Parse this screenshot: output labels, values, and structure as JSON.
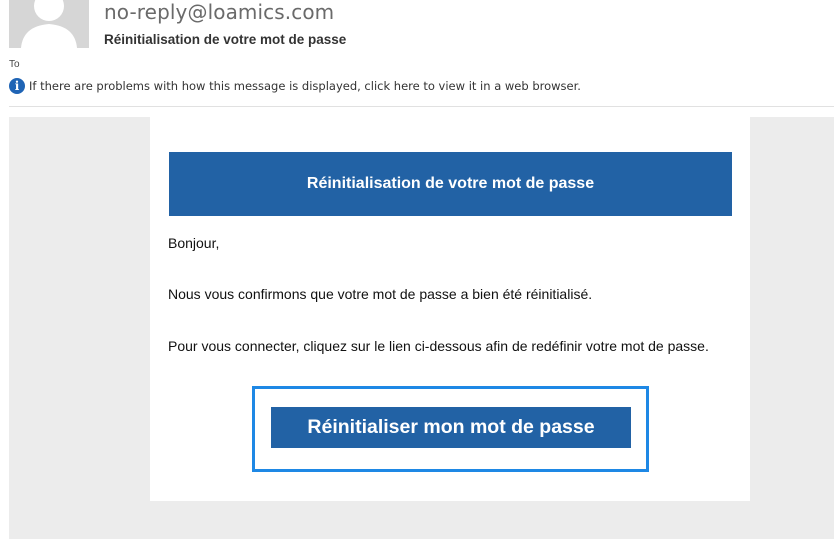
{
  "header": {
    "sender": "no-reply@loamics.com",
    "subject": "Réinitialisation de votre mot de passe",
    "to_label": "To",
    "info_message": "If there are problems with how this message is displayed, click here to view it in a web browser."
  },
  "email": {
    "banner_title": "Réinitialisation de votre mot de passe",
    "greeting": "Bonjour,",
    "paragraph_1": "Nous vous confirmons que votre mot de passe a bien été réinitialisé.",
    "paragraph_2": "Pour vous connecter, cliquez sur le lien ci-dessous afin de redéfinir votre mot de passe.",
    "cta_label": "Réinitialiser mon mot de passe"
  },
  "icons": {
    "avatar": "person-silhouette-icon",
    "info": "info-icon"
  },
  "colors": {
    "brand_blue": "#2262a5",
    "focus_outline": "#1e88e5",
    "background_gray": "#ececec"
  }
}
